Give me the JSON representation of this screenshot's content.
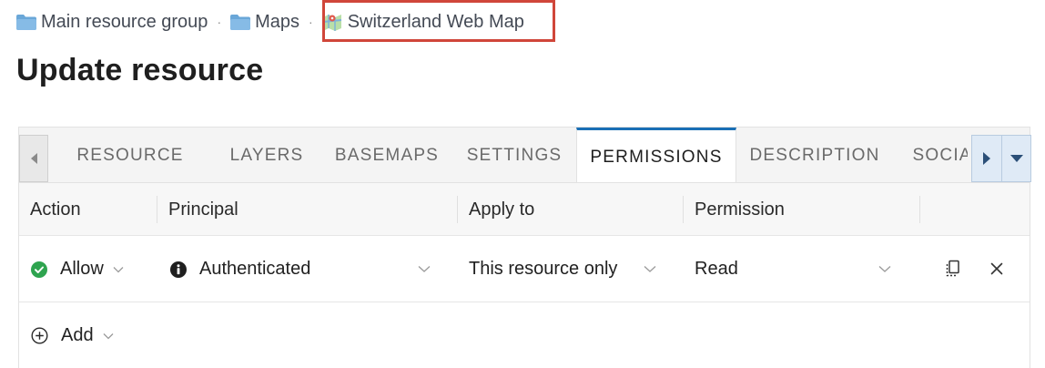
{
  "breadcrumb": {
    "items": [
      {
        "label": "Main resource group",
        "icon": "folder-icon"
      },
      {
        "label": "Maps",
        "icon": "folder-icon"
      },
      {
        "label": "Switzerland Web Map",
        "icon": "web-map-icon"
      }
    ],
    "separator": "·"
  },
  "page_title": "Update resource",
  "tabs": [
    {
      "label": "RESOURCE",
      "active": false
    },
    {
      "label": "LAYERS",
      "active": false
    },
    {
      "label": "BASEMAPS",
      "active": false
    },
    {
      "label": "SETTINGS",
      "active": false
    },
    {
      "label": "PERMISSIONS",
      "active": true
    },
    {
      "label": "DESCRIPTION",
      "active": false
    },
    {
      "label": "SOCIAL",
      "active": false
    }
  ],
  "table": {
    "headers": {
      "action": "Action",
      "principal": "Principal",
      "apply_to": "Apply to",
      "permission": "Permission"
    },
    "rows": [
      {
        "action": "Allow",
        "principal": "Authenticated",
        "apply_to": "This resource only",
        "permission": "Read"
      }
    ],
    "add_label": "Add"
  },
  "colors": {
    "accent": "#1a6fb5",
    "allow_green": "#2ea44f",
    "highlight_border": "#d0463a",
    "folder_blue": "#6aa7d8"
  }
}
